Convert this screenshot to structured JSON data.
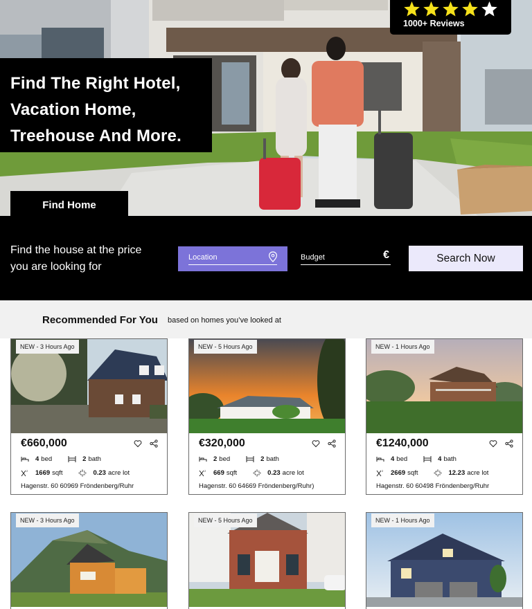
{
  "hero": {
    "headline": [
      "Find The Right Hotel,",
      "Vacation Home,",
      "Treehouse And More."
    ],
    "find_home_label": "Find Home",
    "reviews_label": "1000+ Reviews",
    "stars": 4.5
  },
  "search": {
    "prompt": "Find the house at the price you are looking for",
    "location_placeholder": "Location",
    "budget_placeholder": "Budget",
    "currency_symbol": "€",
    "button_label": "Search Now"
  },
  "recommended": {
    "title": "Recommended For You",
    "subtitle": "based on homes you’ve looked at"
  },
  "listings": [
    {
      "tag": "NEW - 3 Hours Ago",
      "price": "€660,000",
      "beds": "4",
      "baths": "2",
      "sqft": "1669",
      "lot": "0.23",
      "address": "Hagenstr. 60 60969 Fröndenberg/Ruhr"
    },
    {
      "tag": "NEW - 5 Hours Ago",
      "price": "€320,000",
      "beds": "2",
      "baths": "2",
      "sqft": "669",
      "lot": "0.23",
      "address": "Hagenstr. 60 64669 Fröndenberg/Ruhr)"
    },
    {
      "tag": "NEW - 1 Hours Ago",
      "price": "€1240,000",
      "beds": "4",
      "baths": "4",
      "sqft": "2669",
      "lot": "12.23",
      "address": "Hagenstr. 60 60498 Fröndenberg/Ruhr"
    },
    {
      "tag": "NEW - 3 Hours Ago"
    },
    {
      "tag": "NEW - 5 Hours Ago"
    },
    {
      "tag": "NEW - 1 Hours Ago"
    }
  ],
  "units": {
    "bed": "bed",
    "bath": "bath",
    "sqft": "sqft",
    "lot": "acre lot"
  },
  "colors": {
    "accent": "#7c73d9",
    "button_bg": "#ebe9fb",
    "dark": "#000000",
    "section_bg": "#f1f1f1",
    "star": "#f5e11b"
  },
  "icons": [
    "star-icon",
    "location-pin-icon",
    "heart-icon",
    "share-icon",
    "bed-icon",
    "bath-icon",
    "sqft-icon",
    "lot-icon"
  ]
}
